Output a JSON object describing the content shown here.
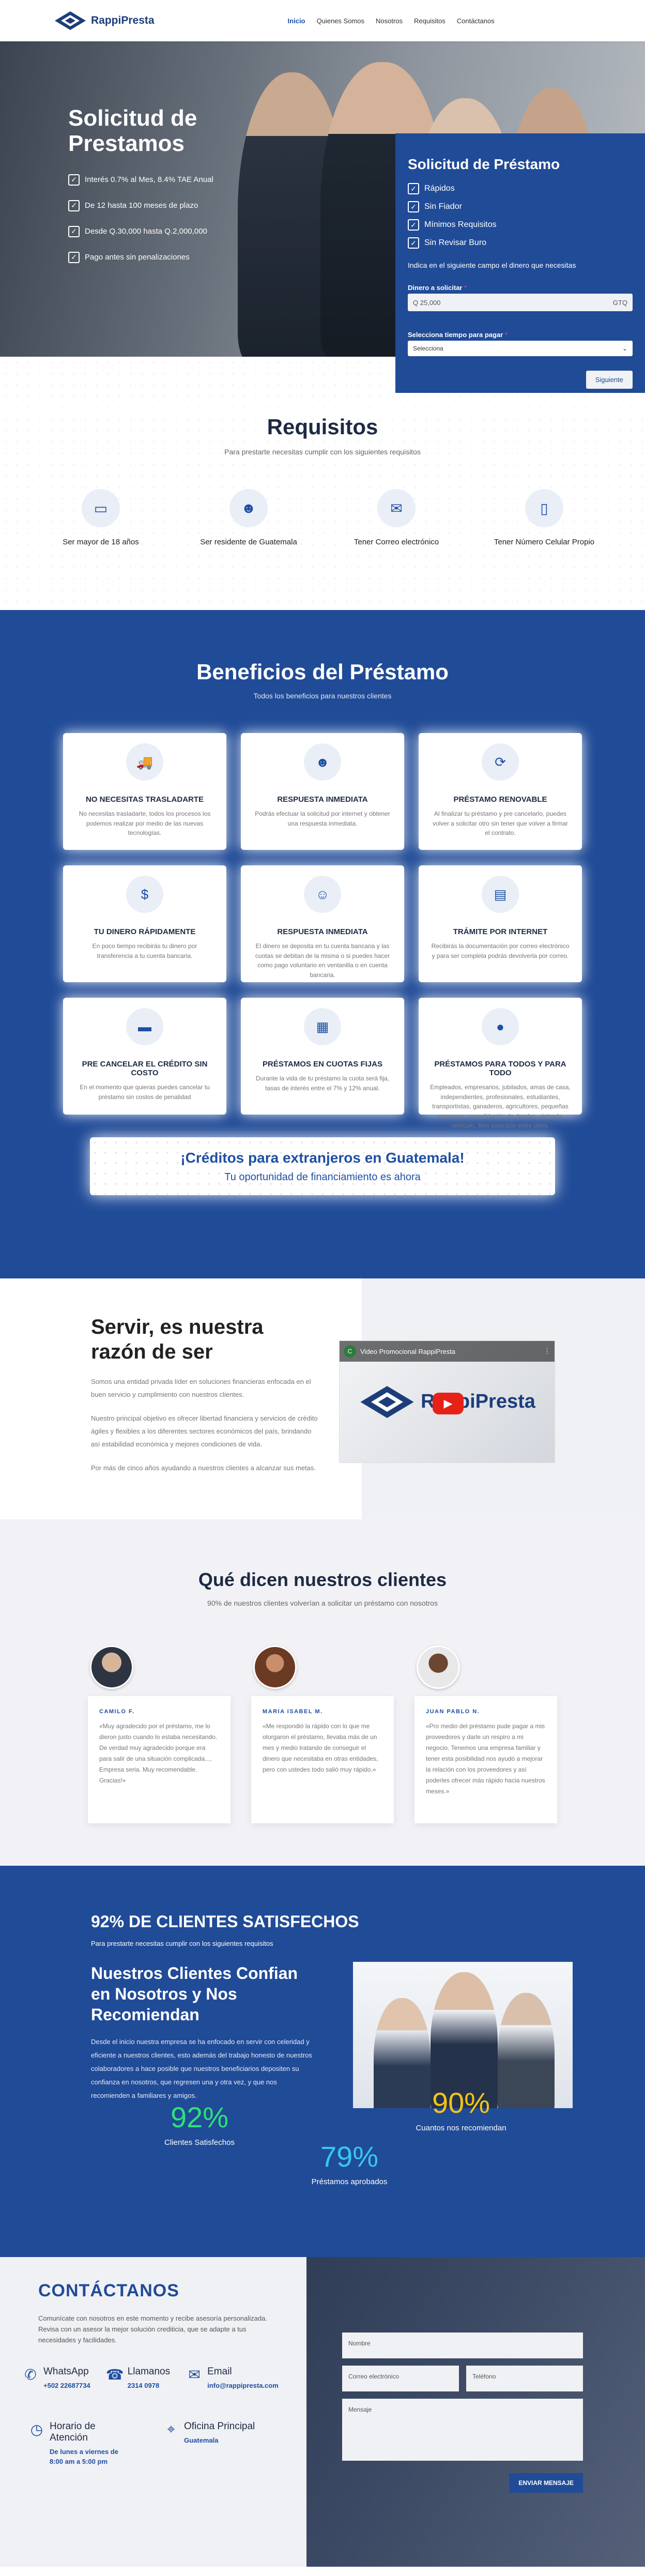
{
  "brand": {
    "name": "RappiPresta"
  },
  "nav": {
    "items": [
      "Inicio",
      "Quienes Somos",
      "Nosotros",
      "Requisitos",
      "Contáctanos"
    ]
  },
  "hero": {
    "title": "Solicitud de Prestamos",
    "bullets": [
      "Interés 0.7% al Mes, 8.4% TAE Anual",
      "De 12 hasta 100 meses de plazo",
      "Desde Q.30,000 hasta Q.2,000,000",
      "Pago antes sin penalizaciones"
    ]
  },
  "loan_form": {
    "title": "Solicitud de Préstamo",
    "features": [
      "Rápidos",
      "Sin Fiador",
      "Mínimos Requisitos",
      "Sin Revisar Buro"
    ],
    "note": "Indica en el siguiente campo el dinero que necesitas",
    "amount_label": "Dinero a solicitar",
    "amount_prefix": "Q",
    "amount_placeholder": "25,000",
    "amount_suffix": "GTQ",
    "term_label": "Selecciona tiempo para pagar",
    "term_value": "Selecciona",
    "required_mark": "*",
    "next_button": "Siguiente"
  },
  "requirements": {
    "title": "Requisitos",
    "subtitle": "Para prestarte necesitas cumplir con los siguientes requisitos",
    "items": [
      {
        "icon": "id-card-icon",
        "label": "Ser mayor de 18 años"
      },
      {
        "icon": "users-icon",
        "label": "Ser residente de Guatemala"
      },
      {
        "icon": "email-icon",
        "label": "Tener Correo electrónico"
      },
      {
        "icon": "phone-icon",
        "label": "Tener Número Celular Propio"
      }
    ]
  },
  "benefits": {
    "title": "Beneficios del Préstamo",
    "subtitle": "Todos los beneficios para nuestros clientes",
    "cards": [
      {
        "icon": "truck-icon",
        "title": "NO NECESITAS TRASLADARTE",
        "desc": "No necesitas trasladarte, todos los procesos los podemos realizar por medio de las nuevas tecnologías."
      },
      {
        "icon": "people-icon",
        "title": "RESPUESTA INMEDIATA",
        "desc": "Podrás efectuar la solicitud por internet y obtener una respuesta inmediata."
      },
      {
        "icon": "renew-icon",
        "title": "PRÉSTAMO RENOVABLE",
        "desc": "Al finalizar tu préstamo y pre cancelarlo, puedes volver a solicitar otro sin tener que volver a firmar el contrato."
      },
      {
        "icon": "dollar-icon",
        "title": "TU DINERO RÁPIDAMENTE",
        "desc": "En poco tiempo recibirás tu dinero por transferencia a tu cuenta bancaria."
      },
      {
        "icon": "group-icon",
        "title": "RESPUESTA INMEDIATA",
        "desc": "El dinero se deposita en tu cuenta bancaria y las cuotas se debitan de la misma o si puedes hacer como pago voluntario en ventanilla o en cuenta bancaria."
      },
      {
        "icon": "document-icon",
        "title": "TRÁMITE POR INTERNET",
        "desc": "Recibirás la documentación por correo electrónico y para ser completa podrás devolverla por correo."
      },
      {
        "icon": "card-icon",
        "title": "PRE CANCELAR EL CRÉDITO SIN COSTO",
        "desc": "En el momento que quieras puedes cancelar tu préstamo sin costos de penalidad"
      },
      {
        "icon": "calendar-icon",
        "title": "PRÉSTAMOS EN CUOTAS FIJAS",
        "desc": "Durante la vida de tu préstamo la cuota será fija, tasas de interés entre el 7% y 12% anual."
      },
      {
        "icon": "money-bag-icon",
        "title": "PRÉSTAMOS PARA TODOS Y PARA TODO",
        "desc": "Empleados, empresarios, jubilados, amas de casa, independientes, profesionales, estudiantes, transportistas, ganaderos, agricultores, pequeñas empresas, consolidación de deudas, vivienda, vehículo, libre inversión entre otros."
      }
    ],
    "banner_title": "¡Créditos para extranjeros en Guatemala!",
    "banner_subtitle": "Tu oportunidad de financiamiento es ahora"
  },
  "about": {
    "title": "Servir, es nuestra razón de ser",
    "paragraphs": [
      "Somos una entidad privada líder en soluciones financieras enfocada en el buen servicio y cumplimiento con nuestros clientes.",
      "Nuestro principal objetivo es ofrecer libertad financiera y servicios de crédito ágiles y flexibles a los diferentes sectores económicos del país, brindando así estabilidad económica y mejores condiciones de vida.",
      "Por más de cinco años ayudando a nuestros clientes a alcanzar sus metas."
    ],
    "video_title": "Video Promocional RappiPresta"
  },
  "testimonials": {
    "title": "Qué dicen nuestros clientes",
    "subtitle": "90% de nuestros clientes volverían a solicitar un préstamo con nosotros",
    "items": [
      {
        "name": "CAMILO F.",
        "text": "«Muy agradecido por el préstamo, me lo dieron justo cuando lo estaba necesitando. De verdad muy agradecido porque era para salir de una situación complicada..., Empresa seria. Muy recomendable. Gracias!»"
      },
      {
        "name": "MARIA ISABEL M.",
        "text": "«Me respondió la rápido con lo que me otorgaron el préstamo, llevaba más de un mes y medio tratando de conseguir el dinero que necesitaba en otras entidades, pero con ustedes todo salió muy rápido.»"
      },
      {
        "name": "JUAN PABLO N.",
        "text": "«Pro medio del préstamo pude pagar a mis proveedores y darle un respiro a mi negocio. Tenemos una empresa familiar y tener esta posibilidad nos ayudó a mejorar la relación con los proveedores y así poderles ofrecer más rápido hacia nuestros meses.»"
      }
    ]
  },
  "stats": {
    "heading": "92% DE CLIENTES SATISFECHOS",
    "subheading": "Para prestarte necesitas cumplir con los siguientes requisitos",
    "title": "Nuestros Clientes Confian en Nosotros y Nos Recomiendan",
    "paragraph": "Desde el inicio nuestra empresa se ha enfocado en servir con celeridad y eficiente a nuestros clientes, esto además del trabajo honesto de nuestros colaboradores a hace posible que nuestros beneficiarios depositen su confianza en nosotros, que regresen una y otra vez, y que nos recomienden a familiares y amigos.",
    "numbers": [
      {
        "value": "92%",
        "label": "Clientes Satisfechos",
        "color": "#2ee07a"
      },
      {
        "value": "90%",
        "label": "Cuantos nos recomiendan",
        "color": "#f0c419"
      },
      {
        "value": "79%",
        "label": "Préstamos aprobados",
        "color": "#39c6f0"
      }
    ]
  },
  "contact": {
    "title": "CONTÁCTANOS",
    "paragraph": "Comunícate con nosotros en este momento y recibe asesoría personalizada. Revisa con un asesor la mejor solución crediticia, que se adapte a tus necesidades y facilidades.",
    "whatsapp_label": "WhatsApp",
    "whatsapp_value": "+502 22687734",
    "call_label": "Llamanos",
    "call_value": "2314 0978",
    "email_label": "Email",
    "email_value": "info@rappipresta.com",
    "hours_label": "Horario de Atención",
    "hours_value": "De lunes a viernes de 8:00 am a 5:00 pm",
    "office_label": "Oficina Principal",
    "office_value": "Guatemala",
    "form": {
      "name": "Nombre",
      "email": "Correo electrónico",
      "phone": "Teléfono",
      "message": "Mensaje",
      "send": "ENVIAR MENSAJE"
    }
  },
  "colors": {
    "primary": "#204b97",
    "dark_text": "#1e2a44"
  }
}
